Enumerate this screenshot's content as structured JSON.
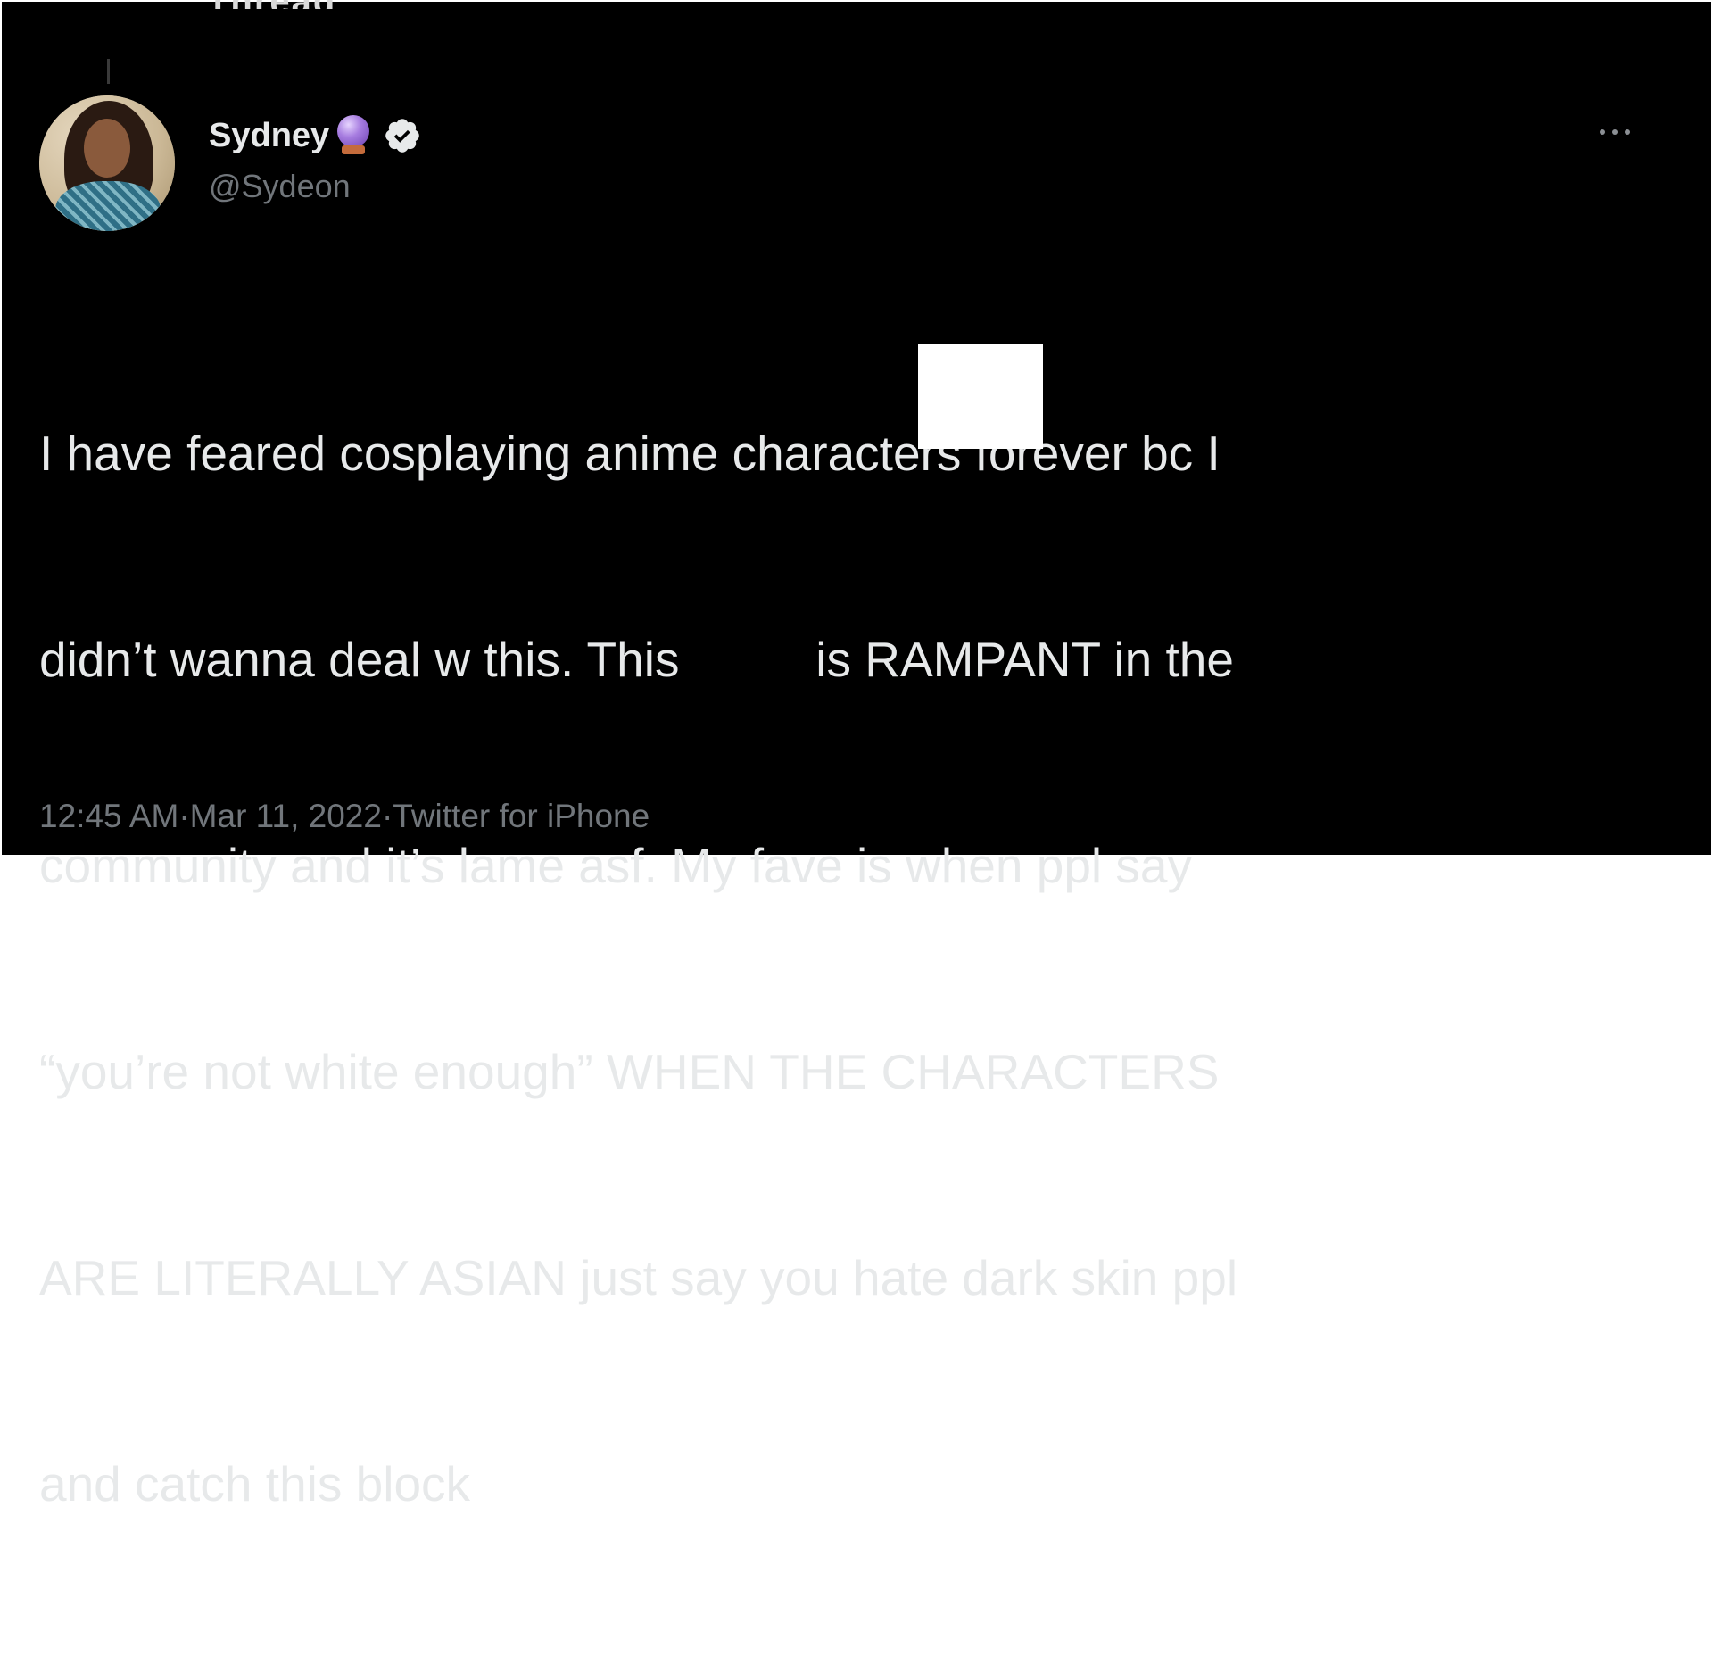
{
  "header": {
    "partial_title": "Thread"
  },
  "tweet": {
    "author": {
      "display_name": "Sydney",
      "handle": "@Sydeon",
      "name_emoji": "crystal-ball-icon",
      "verified_icon": "verified-icon"
    },
    "body_lines": [
      "I have feared cosplaying anime characters forever bc I",
      "didn’t wanna deal w this. This          is RAMPANT in the",
      "community and it’s lame asf. My fave is when ppl say",
      "“you’re not white enough” WHEN THE CHARACTERS",
      "ARE LITERALLY ASIAN just say you hate dark skin ppl",
      "and catch this block"
    ],
    "time": "12:45 AM",
    "separator": " · ",
    "date": "Mar 11, 2022",
    "source": "Twitter for iPhone"
  },
  "colors": {
    "background": "#000000",
    "text": "#e7e9ea",
    "muted": "#71767b",
    "verified_badge": "#e7e9ea"
  }
}
